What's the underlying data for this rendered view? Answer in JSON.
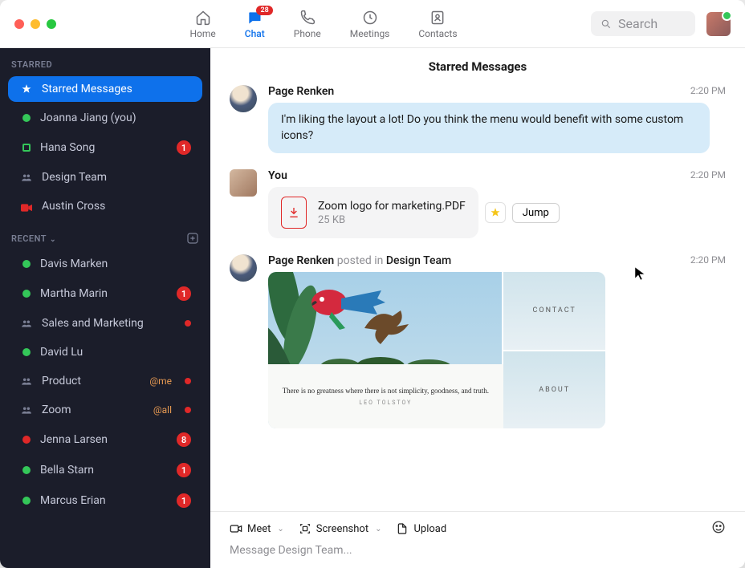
{
  "topnav": {
    "tabs": [
      {
        "label": "Home",
        "icon": "home"
      },
      {
        "label": "Chat",
        "icon": "chat",
        "badge": "28",
        "active": true
      },
      {
        "label": "Phone",
        "icon": "phone"
      },
      {
        "label": "Meetings",
        "icon": "clock"
      },
      {
        "label": "Contacts",
        "icon": "contacts"
      }
    ],
    "search_placeholder": "Search"
  },
  "sidebar": {
    "starred_label": "STARRED",
    "recent_label": "RECENT",
    "starred": [
      {
        "name": "Starred Messages",
        "type": "star",
        "active": true
      },
      {
        "name": "Joanna Jiang (you)",
        "type": "presence-green"
      },
      {
        "name": "Hana Song",
        "type": "presence-away",
        "badge": "1"
      },
      {
        "name": "Design Team",
        "type": "group"
      },
      {
        "name": "Austin Cross",
        "type": "video-red"
      }
    ],
    "recent": [
      {
        "name": "Davis Marken",
        "type": "presence-green"
      },
      {
        "name": "Martha Marin",
        "type": "presence-green",
        "badge": "1"
      },
      {
        "name": "Sales and Marketing",
        "type": "group",
        "dot": true
      },
      {
        "name": "David Lu",
        "type": "presence-green"
      },
      {
        "name": "Product",
        "type": "group",
        "mention": "@me",
        "dot": true
      },
      {
        "name": "Zoom",
        "type": "group",
        "mention": "@all",
        "dot": true
      },
      {
        "name": "Jenna Larsen",
        "type": "presence-red",
        "badge": "8"
      },
      {
        "name": "Bella Starn",
        "type": "presence-green",
        "badge": "1"
      },
      {
        "name": "Marcus Erian",
        "type": "presence-green",
        "badge": "1"
      }
    ]
  },
  "main": {
    "title": "Starred Messages",
    "messages": [
      {
        "sender": "Page Renken",
        "time": "2:20 PM",
        "text": "I'm liking the layout a lot! Do you think the menu would benefit with some custom icons?"
      },
      {
        "sender": "You",
        "time": "2:20 PM",
        "file": {
          "name": "Zoom logo for marketing.PDF",
          "size": "25 KB"
        },
        "jump_label": "Jump"
      },
      {
        "sender": "Page Renken",
        "posted_in_label": "posted in",
        "team": "Design Team",
        "time": "2:20 PM",
        "image": {
          "contact": "CONTACT",
          "about": "ABOUT",
          "quote": "There is no greatness where there is not simplicity, goodness, and truth.",
          "author": "LEO TOLSTOY"
        }
      }
    ],
    "composer": {
      "meet": "Meet",
      "screenshot": "Screenshot",
      "upload": "Upload",
      "placeholder": "Message Design Team..."
    }
  }
}
